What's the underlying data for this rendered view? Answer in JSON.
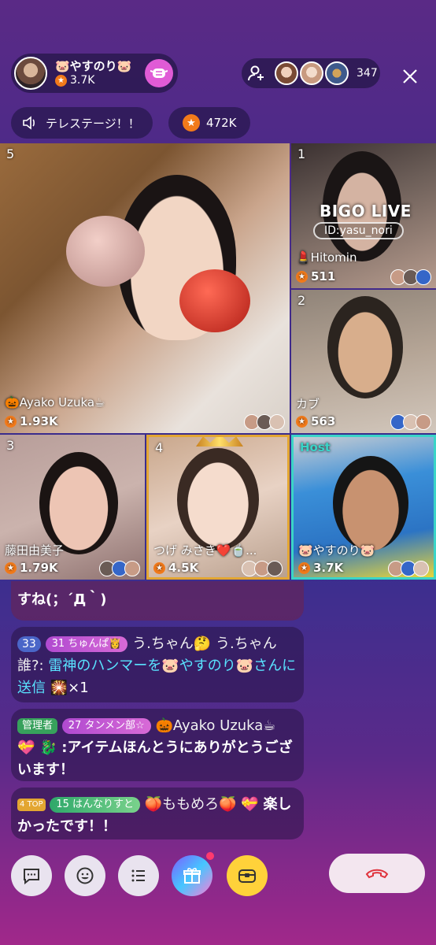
{
  "header": {
    "host_name": "🐷やすのり🐷",
    "host_points": "3.7K",
    "viewer_count": "347",
    "topic": "テレステージ！！",
    "diamonds": "472K"
  },
  "tiles": [
    {
      "num": "5",
      "name": "🎃Ayako Uzuka☕",
      "score": "1.93K"
    },
    {
      "num": "1",
      "name": "💄Hitomin",
      "score": "511",
      "watermark": "BIGO LIVE",
      "watermark_id": "ID:yasu_nori"
    },
    {
      "num": "2",
      "name": "カブ",
      "score": "563"
    },
    {
      "num": "3",
      "name": "藤田由美子",
      "score": "1.79K"
    },
    {
      "num": "4",
      "name": "つげ みさき❤️🍵...",
      "score": "4.5K"
    },
    {
      "num": "Host",
      "name": "🐷やすのり🐷",
      "score": "3.7K"
    }
  ],
  "chat": {
    "m0": {
      "text": "すね(；´Д｀)"
    },
    "m1": {
      "level": "33",
      "badge_level": "31",
      "badge": "ちゅんぱ👸",
      "user": "う.ちゃん🤔",
      "text_a": "う.ちゃん誰?:",
      "text_b": "雷神のハンマーを🐷やすのり🐷さんに送信",
      "gift": "🎇×1"
    },
    "m2": {
      "admin": "管理者",
      "badge_level": "27",
      "badge": "タンメン部☆",
      "user": "🎃Ayako Uzuka☕",
      "icons": "💝 🐉",
      "text": ":アイテムほんとうにありがとうございます！"
    },
    "m3": {
      "top": "4",
      "top_label": "TOP",
      "badge_level": "15",
      "badge": "はんなりすと",
      "user": "🍑ももめろ🍑",
      "icon": "💝",
      "text": "楽しかったです！！"
    }
  },
  "colors": {
    "accent": "#e05bd6",
    "star": "#f27a1a",
    "host_border": "#3ad4c8",
    "top_border": "#e3a632"
  }
}
